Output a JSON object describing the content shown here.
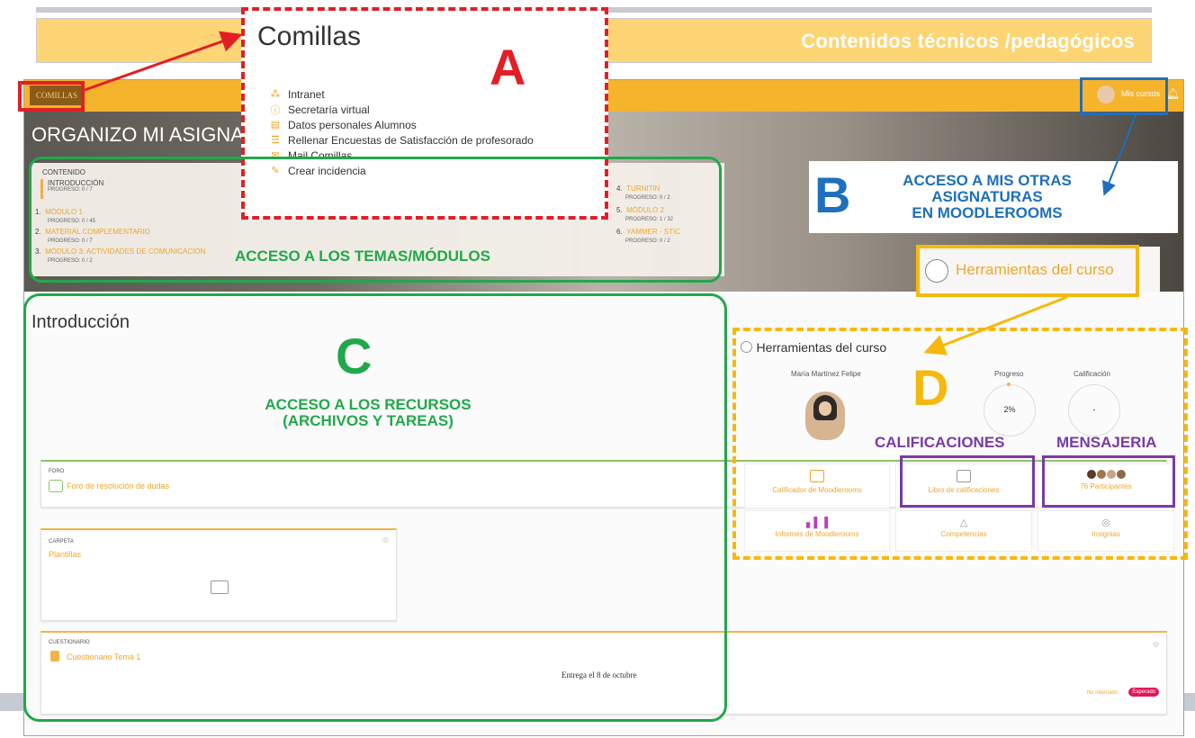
{
  "banner": {
    "title": "Contenidos técnicos /pedagógicos"
  },
  "moodle": {
    "logo_text": "COMILLAS",
    "mis_cursos": "Mis cursos",
    "course_title": "ORGANIZO MI ASIGNATU",
    "contenido_label": "CONTENIDO",
    "modules_left": [
      {
        "num": "",
        "label": "INTRODUCCIÓN",
        "progress": "PROGRESO: 0 / 7"
      },
      {
        "num": "1.",
        "label": "MÓDULO 1",
        "progress": "PROGRESO: 0 / 45"
      },
      {
        "num": "2.",
        "label": "MATERIAL COMPLEMENTARIO",
        "progress": "PROGRESO: 0 / 7"
      },
      {
        "num": "3.",
        "label": "MÓDULO 3: ACTIVIDADES DE COMUNICACIÓN",
        "progress": "PROGRESO: 0 / 2"
      }
    ],
    "modules_right": [
      {
        "num": "4.",
        "label": "TURNITIN",
        "progress": "PROGRESO: 0 / 2"
      },
      {
        "num": "5.",
        "label": "MÓDULO 2",
        "progress": "PROGRESO: 1 / 32"
      },
      {
        "num": "6.",
        "label": "YAMMER - STIC",
        "progress": "PROGRESO: 0 / 2"
      }
    ],
    "tools_button": "Herramientas del curso",
    "section_title": "Introducción",
    "resources": {
      "foro": {
        "type": "FORO",
        "name": "Foro de resolución de dudas"
      },
      "carpeta": {
        "type": "CARPETA",
        "name": "Plantillas"
      },
      "cuestionario": {
        "type": "CUESTIONARIO",
        "name": "Cuestionario Tema 1",
        "due": "Entrega el 8 de octubre",
        "status_label": "No intentado",
        "status_badge": "Esperado"
      }
    },
    "tools_panel": {
      "title": "Herramientas del curso",
      "user_name": "María Martínez Felipe",
      "progreso_label": "Progreso",
      "progreso_value": "2%",
      "calificacion_label": "Calificación",
      "calificacion_value": "-",
      "tiles": [
        "Calificador de Moodlerooms",
        "Libro de calificaciones",
        "76 Participantes",
        "Informes de Moodlerooms",
        "Competencias",
        "Insignias"
      ]
    }
  },
  "popup_menu": {
    "title": "Comillas",
    "items": [
      "Intranet",
      "Secretaría virtual",
      "Datos personales Alumnos",
      "Rellenar Encuestas de Satisfacción de profesorado",
      "Mail Comillas",
      "Crear incidencia"
    ]
  },
  "annotations": {
    "A": "A",
    "B": "B",
    "C": "C",
    "D": "D",
    "modules_caption": "ACCESO A LOS TEMAS/MÓDULOS",
    "other_courses_caption_1": "ACCESO A MIS OTRAS",
    "other_courses_caption_2": "ASIGNATURAS",
    "other_courses_caption_3": "EN MOODLEROOMS",
    "resources_caption_1": "ACCESO A LOS RECURSOS",
    "resources_caption_2": "(ARCHIVOS Y TAREAS)",
    "calificaciones_caption": "CALIFICACIONES",
    "mensajeria_caption": "MENSAJERIA"
  },
  "colors": {
    "red": "#e21f26",
    "green": "#21a84a",
    "blue": "#1e6fbd",
    "yellow": "#f6b80f",
    "purple": "#7a3aa6",
    "orange": "#f6b42c"
  }
}
